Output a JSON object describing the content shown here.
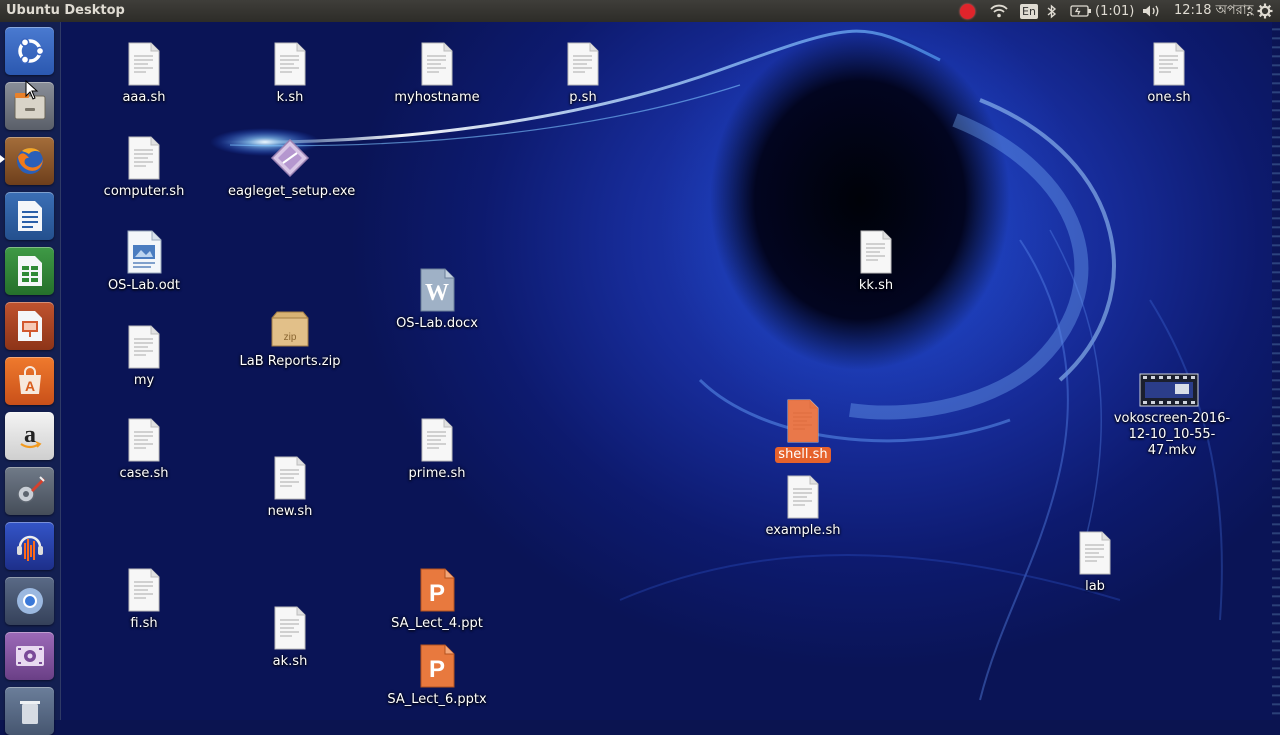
{
  "panel": {
    "title": "Ubuntu Desktop",
    "battery": "(1:01)",
    "keyboard": "En",
    "clock": "12:18 অপরাহ্ণ"
  },
  "launcher": {
    "items": [
      {
        "name": "dash-home",
        "icon": "ubuntu-logo-icon"
      },
      {
        "name": "files",
        "icon": "file-manager-icon"
      },
      {
        "name": "firefox",
        "icon": "firefox-icon"
      },
      {
        "name": "libreoffice-writer",
        "icon": "writer-icon"
      },
      {
        "name": "libreoffice-calc",
        "icon": "calc-icon"
      },
      {
        "name": "libreoffice-impress",
        "icon": "impress-icon"
      },
      {
        "name": "ubuntu-software",
        "icon": "software-center-icon"
      },
      {
        "name": "amazon",
        "icon": "amazon-icon"
      },
      {
        "name": "system-settings",
        "icon": "settings-icon"
      },
      {
        "name": "audacity",
        "icon": "audacity-icon"
      },
      {
        "name": "chromium",
        "icon": "chromium-icon"
      },
      {
        "name": "screen-recorder",
        "icon": "video-recorder-icon"
      },
      {
        "name": "trash",
        "icon": "trash-icon"
      }
    ]
  },
  "desktop": {
    "icons": [
      {
        "label": "aaa.sh",
        "type": "text"
      },
      {
        "label": "k.sh",
        "type": "text"
      },
      {
        "label": "myhostname",
        "type": "text"
      },
      {
        "label": "p.sh",
        "type": "text"
      },
      {
        "label": "one.sh",
        "type": "text"
      },
      {
        "label": "computer.sh",
        "type": "text"
      },
      {
        "label": "eagleget_setup.exe",
        "type": "exe"
      },
      {
        "label": "OS-Lab.odt",
        "type": "odt"
      },
      {
        "label": "kk.sh",
        "type": "text"
      },
      {
        "label": "OS-Lab.docx",
        "type": "docx"
      },
      {
        "label": "my",
        "type": "text"
      },
      {
        "label": "LaB Reports.zip",
        "type": "zip"
      },
      {
        "label": "vokoscreen-2016-12-10_10-55-47.mkv",
        "type": "video"
      },
      {
        "label": "case.sh",
        "type": "text"
      },
      {
        "label": "prime.sh",
        "type": "text"
      },
      {
        "label": "shell.sh",
        "type": "text",
        "selected": true
      },
      {
        "label": "new.sh",
        "type": "text"
      },
      {
        "label": "example.sh",
        "type": "text"
      },
      {
        "label": "lab",
        "type": "text"
      },
      {
        "label": "fi.sh",
        "type": "text"
      },
      {
        "label": "SA_Lect_4.ppt",
        "type": "ppt"
      },
      {
        "label": "ak.sh",
        "type": "text"
      },
      {
        "label": "SA_Lect_6.pptx",
        "type": "ppt"
      }
    ],
    "zip_badge": "zip",
    "selection_color": "#e6622c"
  }
}
